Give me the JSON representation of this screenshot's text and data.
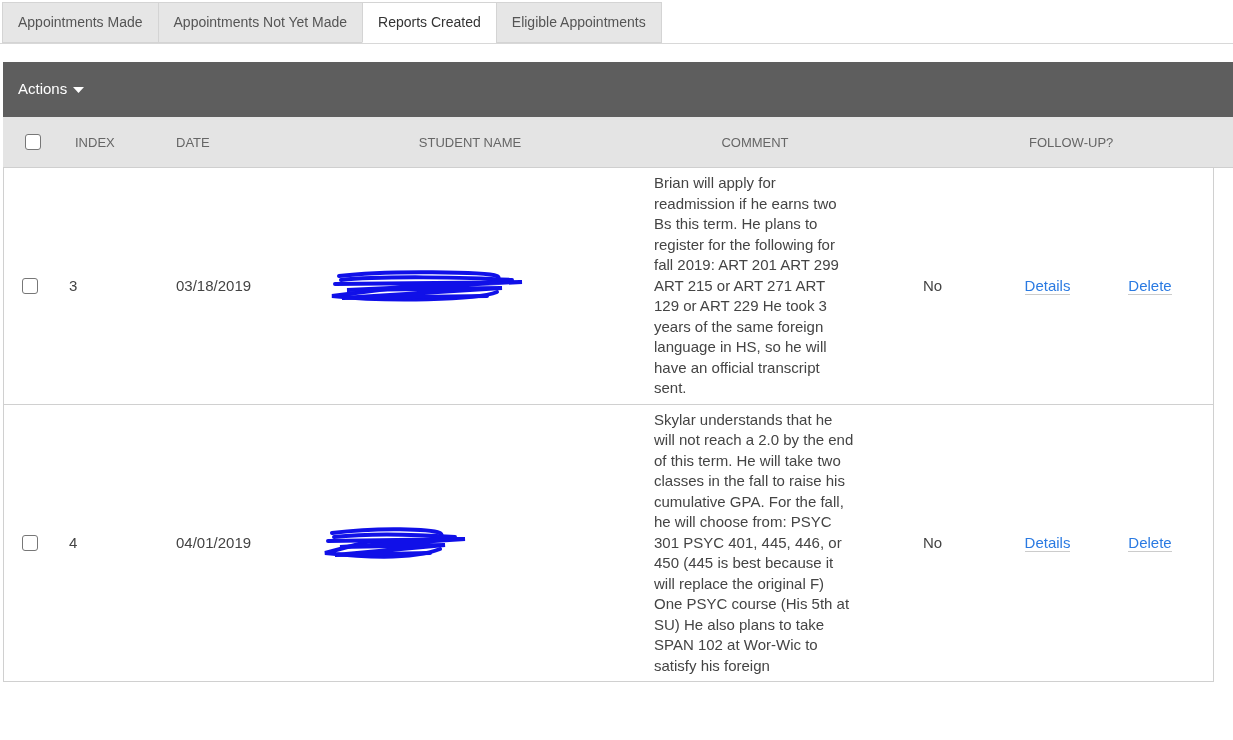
{
  "tabs": [
    {
      "label": "Appointments Made",
      "selected": false
    },
    {
      "label": "Appointments Not Yet Made",
      "selected": false
    },
    {
      "label": "Reports Created",
      "selected": true
    },
    {
      "label": "Eligible Appointments",
      "selected": false
    }
  ],
  "toolbar": {
    "actions_label": "Actions"
  },
  "table": {
    "select_all_checked": false,
    "columns": [
      "INDEX",
      "DATE",
      "STUDENT NAME",
      "COMMENT",
      "FOLLOW-UP?"
    ],
    "rows": [
      {
        "checked": false,
        "index": "3",
        "date": "03/18/2019",
        "comment": "Brian will apply for readmission if he earns two Bs this term. He plans to register for the following for fall 2019: ART 201 ART 299 ART 215 or ART 271 ART 129 or ART 229 He took 3 years of the same foreign language in HS, so he will have an official transcript sent.",
        "follow_up": "No",
        "details": "Details",
        "delete": "Delete"
      },
      {
        "checked": false,
        "index": "4",
        "date": "04/01/2019",
        "comment": "Skylar understands that he will not reach a 2.0 by the end of this term.  He will take two classes in the fall to raise his cumulative GPA.  For the fall, he will choose from: PSYC 301 PSYC 401, 445, 446, or 450 (445 is best because it will replace the original F) One PSYC course (His 5th at SU) He also plans to take SPAN 102 at Wor-Wic to satisfy his foreign",
        "follow_up": "No",
        "details": "Details",
        "delete": "Delete"
      }
    ]
  }
}
